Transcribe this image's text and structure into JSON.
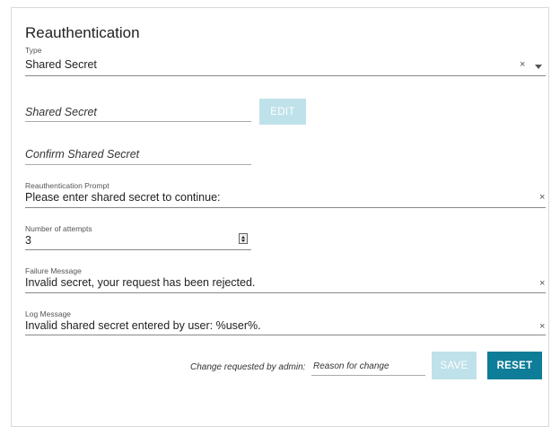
{
  "section": {
    "title": "Reauthentication"
  },
  "type_field": {
    "label": "Type",
    "value": "Shared Secret",
    "clear": "×"
  },
  "shared_secret": {
    "placeholder": "Shared Secret",
    "edit_label": "EDIT"
  },
  "confirm_secret": {
    "placeholder": "Confirm Shared Secret"
  },
  "prompt": {
    "label": "Reauthentication Prompt",
    "value": "Please enter shared secret to continue:",
    "clear": "×"
  },
  "attempts": {
    "label": "Number of attempts",
    "value": "3"
  },
  "failure": {
    "label": "Failure Message",
    "value": "Invalid secret, your request has been rejected.",
    "clear": "×"
  },
  "log": {
    "label": "Log Message",
    "value": "Invalid shared secret entered by user: %user%.",
    "clear": "×"
  },
  "footer": {
    "change_label": "Change requested by admin:",
    "reason_placeholder": "Reason for change",
    "save_label": "SAVE",
    "reset_label": "RESET"
  },
  "colors": {
    "primary": "#0e7d98",
    "disabled": "#bfe1ea"
  }
}
